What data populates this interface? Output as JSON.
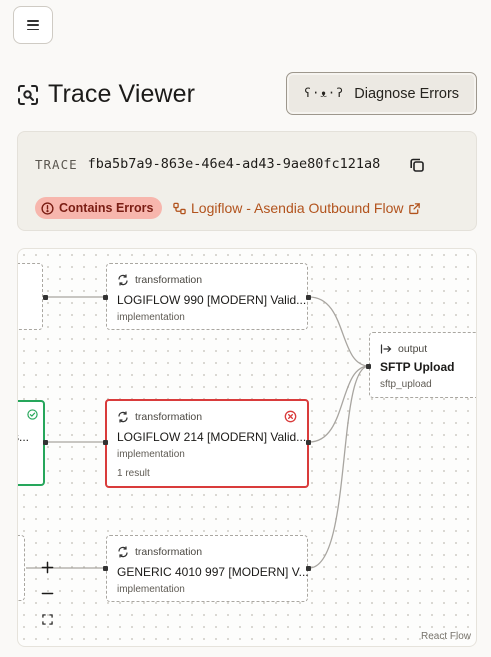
{
  "page": {
    "title": "Trace Viewer",
    "diagnose_glyph": "ʕ·ᴥ·ʔ",
    "diagnose_label": "Diagnose Errors"
  },
  "trace": {
    "label": "TRACE",
    "id": "fba5b7a9-863e-46e4-ad43-9ae80fc121a8",
    "status_badge": "Contains Errors",
    "flow_link": "Logiflow - Asendia Outbound Flow"
  },
  "flow": {
    "nodes": [
      {
        "kind": "transformation",
        "name": "LOGIFLOW 990 [MODERN] Valid...",
        "sub": "implementation",
        "result": "",
        "status": "idle"
      },
      {
        "kind": "transformation",
        "name": "LOGIFLOW 214 [MODERN] Valid...",
        "sub": "implementation",
        "result": "1 result",
        "status": "error"
      },
      {
        "kind": "transformation",
        "name": "GENERIC 4010 997 [MODERN] V...",
        "sub": "implementation",
        "result": "",
        "status": "idle"
      },
      {
        "kind": "output",
        "name": "SFTP Upload",
        "sub": "sftp_upload",
        "result": "",
        "status": "idle"
      }
    ],
    "partial_left_label": "s...",
    "watermark": "React Flow"
  },
  "colors": {
    "error": "#d93b3b",
    "success": "#26a65b",
    "badge_bg": "#f7b6ad",
    "link": "#b2531d"
  }
}
